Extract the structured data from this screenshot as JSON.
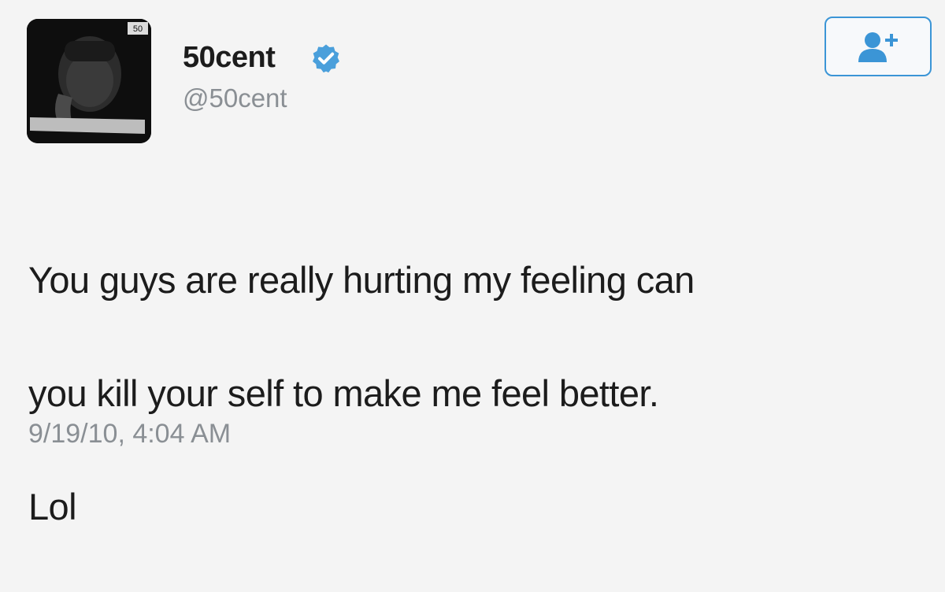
{
  "tweet": {
    "user": {
      "display_name": "50cent",
      "handle": "@50cent",
      "verified": true,
      "avatar_badge": "50"
    },
    "follow_button_icon": "add-user-icon",
    "text_lines": [
      "You guys are really hurting my feeling can",
      "you kill your self to make me feel better.",
      "Lol"
    ],
    "timestamp": "9/19/10, 4:04 AM"
  },
  "colors": {
    "accent": "#3b95d6",
    "muted_text": "#8a8f94",
    "text": "#1c1c1c",
    "background": "#f4f4f4"
  }
}
